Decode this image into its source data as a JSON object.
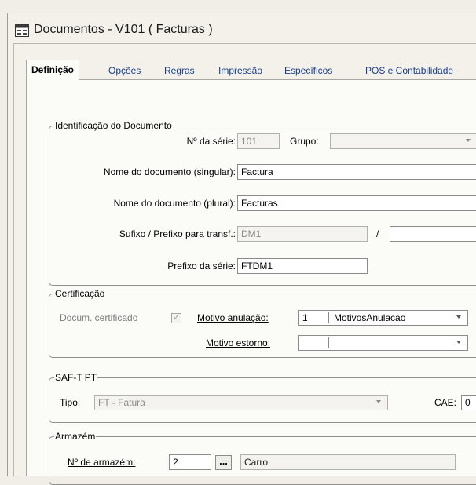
{
  "window": {
    "title": "Documentos - V101 ( Facturas )"
  },
  "tabs": [
    "Definição",
    "Opções",
    "Regras",
    "Impressão",
    "Específicos",
    "POS e Contabilidade"
  ],
  "identificacao": {
    "group_title": "Identificação do Documento",
    "serie_label": "Nº da série:",
    "serie_value": "101",
    "grupo_label": "Grupo:",
    "grupo_value": "",
    "nome_singular_label": "Nome do documento (singular):",
    "nome_singular_value": "Factura",
    "nome_plural_label": "Nome do documento (plural):",
    "nome_plural_value": "Facturas",
    "sufixo_label": "Sufixo / Prefixo para transf.:",
    "sufixo_value": "DM1",
    "sufixo_sep": "/",
    "sufixo_value2": "",
    "prefixo_label": "Prefixo da série:",
    "prefixo_value": "FTDM1"
  },
  "certificacao": {
    "group_title": "Certificação",
    "certificado_label": "Docum. certificado",
    "certificado_checked": true,
    "motivo_anulacao_label": "Motivo anulação:",
    "motivo_anulacao_code": "1",
    "motivo_anulacao_desc": "MotivosAnulacao",
    "motivo_estorno_label": "Motivo estorno:",
    "motivo_estorno_code": "",
    "motivo_estorno_desc": ""
  },
  "saft": {
    "group_title": "SAF-T PT",
    "tipo_label": "Tipo:",
    "tipo_value": "FT - Fatura",
    "cae_label": "CAE:",
    "cae_value": "0"
  },
  "armazem": {
    "group_title": "Armazém",
    "numero_label": "Nº de armazém:",
    "numero_value": "2",
    "browse_label": "...",
    "nome_value": "Carro"
  }
}
